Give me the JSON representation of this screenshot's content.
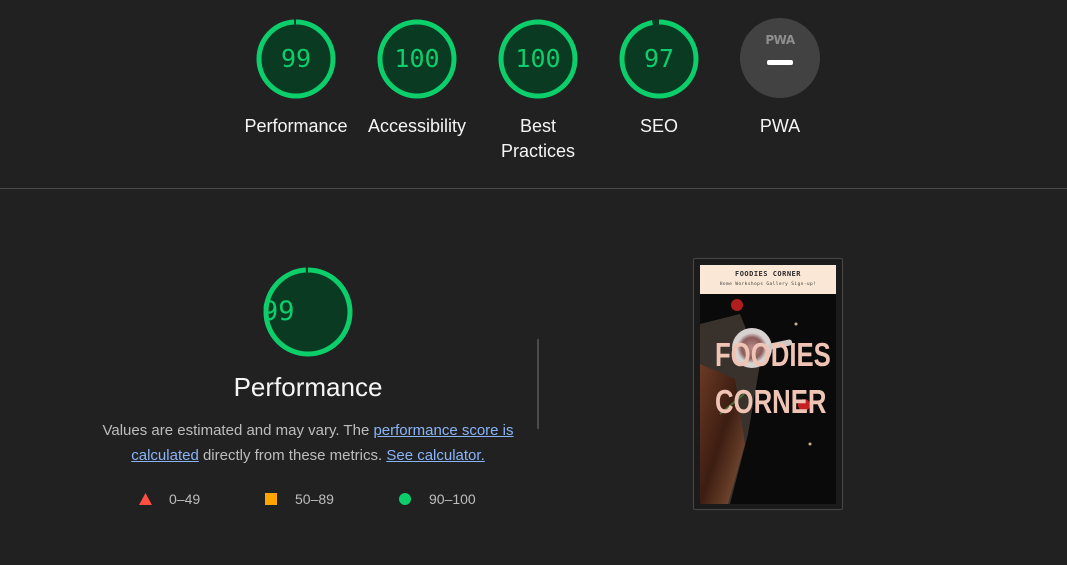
{
  "scores": [
    {
      "label": "Performance",
      "value": "99",
      "fraction": 0.99
    },
    {
      "label": "Accessibility",
      "value": "100",
      "fraction": 1.0
    },
    {
      "label_line1": "Best",
      "label_line2": "Practices",
      "value": "100",
      "fraction": 1.0
    },
    {
      "label": "SEO",
      "value": "97",
      "fraction": 0.97
    }
  ],
  "pwa": {
    "label": "PWA",
    "badge_text": "PWA"
  },
  "performance": {
    "score": "99",
    "fraction": 0.99,
    "title": "Performance",
    "desc_prefix": "Values are estimated and may vary. The ",
    "desc_link1": "performance score is calculated",
    "desc_middle": " directly from these metrics. ",
    "desc_link2": "See calculator.",
    "legend": [
      {
        "range": "0–49",
        "shape": "triangle",
        "color": "#ff4e42"
      },
      {
        "range": "50–89",
        "shape": "square",
        "color": "#ffa400"
      },
      {
        "range": "90–100",
        "shape": "circle",
        "color": "#0cce6b"
      }
    ]
  },
  "thumbnail": {
    "brand": "FOODIES CORNER",
    "nav": "Home  Workshops  Gallery  Sign-up!",
    "hero_line1": "FOODIES",
    "hero_line2": "CORNER"
  },
  "colors": {
    "pass": "#0cce6b",
    "pass_bg": "#0b3a23",
    "background": "#212121",
    "link": "#8ab4f8"
  }
}
